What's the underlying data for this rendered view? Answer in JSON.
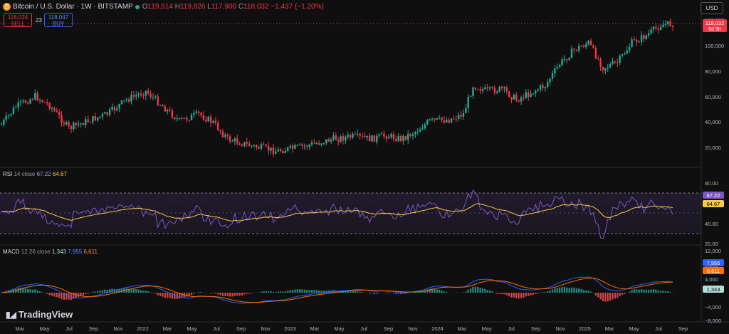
{
  "header": {
    "title": "Bitcoin / U.S. Dollar · 1W · BITSTAMP",
    "o_label": "O",
    "o": "119,514",
    "h_label": "H",
    "h": "119,826",
    "l_label": "L",
    "l": "117,900",
    "c_label": "C",
    "c": "118,032",
    "change": "−1,437 (−1.20%)"
  },
  "trade": {
    "sell_price": "118,024",
    "sell_label": "SELL",
    "spread": "23",
    "buy_price": "118,047",
    "buy_label": "BUY"
  },
  "currency": "USD",
  "last_price": {
    "value": "118,032",
    "countdown": "6d 9h"
  },
  "price_axis": [
    "120,000",
    "100,000",
    "80,000",
    "60,000",
    "40,000",
    "20,000"
  ],
  "rsi": {
    "name": "RSI",
    "params": "14 close",
    "value": "67.22",
    "ma": "64.67",
    "axis": [
      "80.00",
      "60.00",
      "40.00",
      "20.00"
    ]
  },
  "macd": {
    "name": "MACD",
    "params": "12 26 close",
    "hist": "1,343",
    "macd": "7,955",
    "signal": "6,611",
    "axis": [
      "12,000",
      "8,000",
      "4,000",
      "0",
      "−4,000",
      "−8,000"
    ]
  },
  "time_axis": [
    "Mar",
    "May",
    "Jul",
    "Sep",
    "Nov",
    "2022",
    "Mar",
    "May",
    "Jul",
    "Sep",
    "Nov",
    "2023",
    "Mar",
    "May",
    "Jul",
    "Sep",
    "Nov",
    "2024",
    "Mar",
    "May",
    "Jul",
    "Sep",
    "Nov",
    "2025",
    "Mar",
    "May",
    "Jul",
    "Sep"
  ],
  "branding": "TradingView",
  "colors": {
    "up": "#22ab94",
    "down": "#f23645",
    "rsi": "#7e57c2",
    "rsi_ma": "#f7c948",
    "macd": "#2962ff",
    "signal": "#ff6d00"
  }
}
